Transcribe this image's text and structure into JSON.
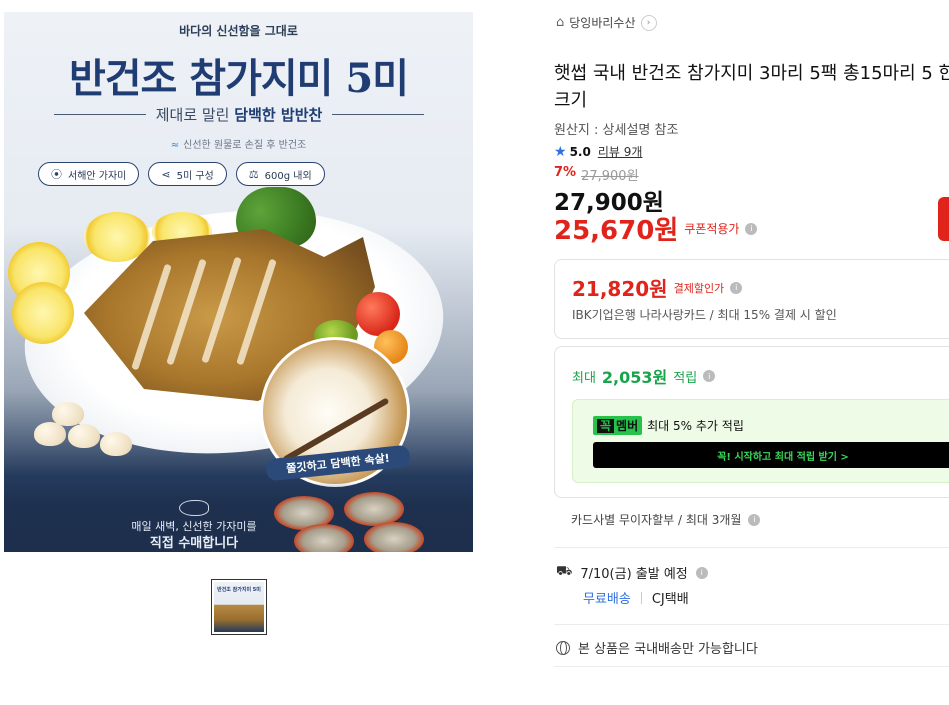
{
  "hero": {
    "kicker": "바다의 신선함을 그대로",
    "title": "반건조 참가지미 5미",
    "subtitle_pre": "제대로 말린 ",
    "subtitle_bold": "담백한 밥반찬",
    "note": "신선한 원물로 손질 후 반건조",
    "pills": [
      {
        "icon": "location-pin-icon",
        "label": "서해안 가자미"
      },
      {
        "icon": "fish-icon",
        "label": "5미 구성"
      },
      {
        "icon": "scale-icon",
        "label": "600g 내외"
      }
    ],
    "inset_caption": "쫄깃하고 담백한 속살!",
    "bottom_line1": "매일 새벽, 신선한 가자미를",
    "bottom_line2": "직접 수매합니다"
  },
  "thumbnail": {
    "caption": "반건조 참가지미 5미"
  },
  "store": {
    "name": "당잉바리수산"
  },
  "product": {
    "title": "햇썹 국내 반건조 참가지미 3마리 5팩 총15마리 5 한 크기",
    "origin": "원산지 : 상세설명 참조",
    "rating": "5.0",
    "reviews": "리뷰 9개",
    "discount_pct": "7%",
    "original_price": "27,900원",
    "price": "27,900원",
    "coupon_price": "25,670원",
    "coupon_label": "쿠폰적용가"
  },
  "payment_discount": {
    "price": "21,820원",
    "label": "결제할인가",
    "desc": "IBK기업은행 나라사랑카드 / 최대 15% 결제 시 할인"
  },
  "points": {
    "prefix": "최대",
    "amount": "2,053원",
    "suffix": "적립",
    "member_badge_a": "꼭",
    "member_badge_b": "멤버",
    "member_text": "최대 5% 추가 적립",
    "cta": "꼭! 시작하고 최대 적립 받기  >"
  },
  "installment": "카드사별 무이자할부 / 최대 3개월",
  "shipping": {
    "date": "7/10(금) 출발 예정",
    "fee": "무료배송",
    "courier": "CJ택배"
  },
  "domestic_note": "본 상품은 국내배송만 가능합니다",
  "colors": {
    "accent_red": "#e0241b",
    "accent_green": "#1aa34a",
    "link_blue": "#2f6fe0"
  }
}
